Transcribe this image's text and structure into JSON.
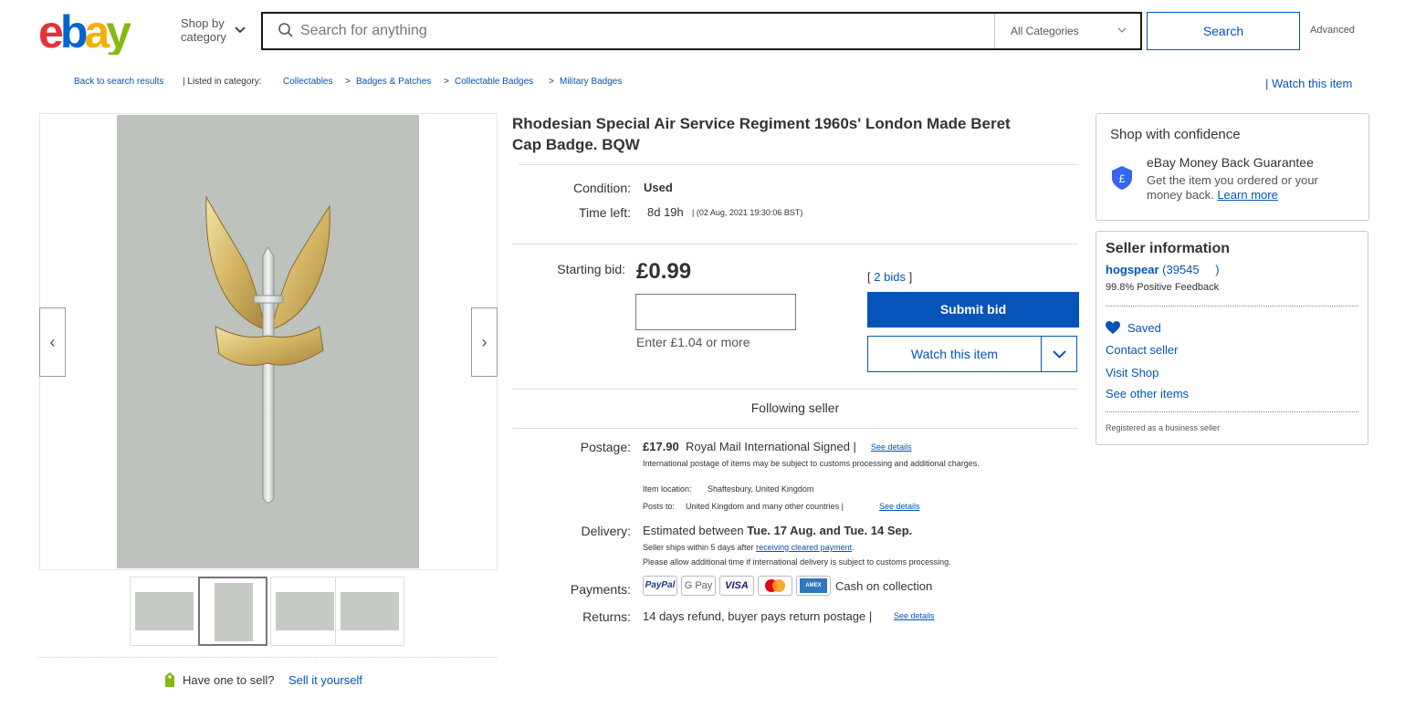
{
  "header": {
    "shop_by_line1": "Shop by",
    "shop_by_line2": "category",
    "search_placeholder": "Search for anything",
    "category_select": "All Categories",
    "search_button": "Search",
    "advanced": "Advanced"
  },
  "breadcrumb": {
    "back": "Back to search results",
    "listed_in": "| Listed in category:",
    "items": [
      "Collectables",
      "Badges & Patches",
      "Collectable Badges",
      "Military Badges"
    ],
    "separator": ">",
    "watch_top": "| Watch this item"
  },
  "gallery": {
    "prev_glyph": "‹",
    "next_glyph": "›",
    "thumbnail_count": 4,
    "active_thumbnail": 2,
    "have_one": "Have one to sell?",
    "sell_it": "Sell it yourself"
  },
  "item": {
    "title_line1": "Rhodesian Special Air Service Regiment 1960s' London Made Beret",
    "title_line2": "Cap Badge. BQW",
    "condition_label": "Condition:",
    "condition_value": "Used",
    "time_left_label": "Time left:",
    "time_left_value": "8d 19h",
    "time_left_date": "| (02 Aug, 2021   19:30:06 BST)",
    "starting_bid_label": "Starting bid:",
    "price": "£0.99",
    "bid_input_value": "",
    "enter_more": "Enter £1.04 or more",
    "bids_open": "[",
    "bids_link": "2 bids",
    "bids_close": "]",
    "submit_bid": "Submit bid",
    "watch_item": "Watch this item",
    "following_seller": "Following seller"
  },
  "shipping": {
    "postage_label": "Postage:",
    "postage_price": "£17.90",
    "postage_service": "Royal Mail International Signed |",
    "see_details": "See details",
    "intl_note": "International postage of items may be subject to customs processing and additional charges.",
    "item_location_label": "Item location:",
    "item_location": "Shaftesbury, United Kingdom",
    "posts_to_label": "Posts to:",
    "posts_to": "United Kingdom and many other countries |",
    "delivery_label": "Delivery:",
    "delivery_prefix": "Estimated between",
    "delivery_range": "Tue. 17 Aug. and Tue. 14 Sep.",
    "ships_within": "Seller ships within 5 days after",
    "receiving_payment": "receiving cleared payment",
    "ships_within_end": ".",
    "customs_note": "Please allow additional time if international delivery is subject to customs processing.",
    "payments_label": "Payments:",
    "payment_methods": [
      "PayPal",
      "G Pay",
      "VISA",
      "Mastercard",
      "AMEX"
    ],
    "cash_on_collection": "Cash on collection",
    "returns_label": "Returns:",
    "returns_value": "14 days refund, buyer pays return postage |"
  },
  "confidence": {
    "title": "Shop with confidence",
    "guarantee_title": "eBay Money Back Guarantee",
    "guarantee_desc": "Get the item you ordered or your money back.",
    "learn_more": "Learn more"
  },
  "seller": {
    "title": "Seller information",
    "name": "hogspear",
    "feedback_score": "(39545",
    "feedback_close": ")",
    "positive": "99.8% Positive Feedback",
    "saved": "Saved",
    "contact": "Contact seller",
    "visit_shop": "Visit Shop",
    "other_items": "See other items",
    "registered": "Registered as a business seller"
  },
  "colors": {
    "link": "#0654ba",
    "ebay_red": "#e53238",
    "ebay_blue": "#0064d2",
    "ebay_yellow": "#f5af02",
    "ebay_green": "#86b817"
  }
}
